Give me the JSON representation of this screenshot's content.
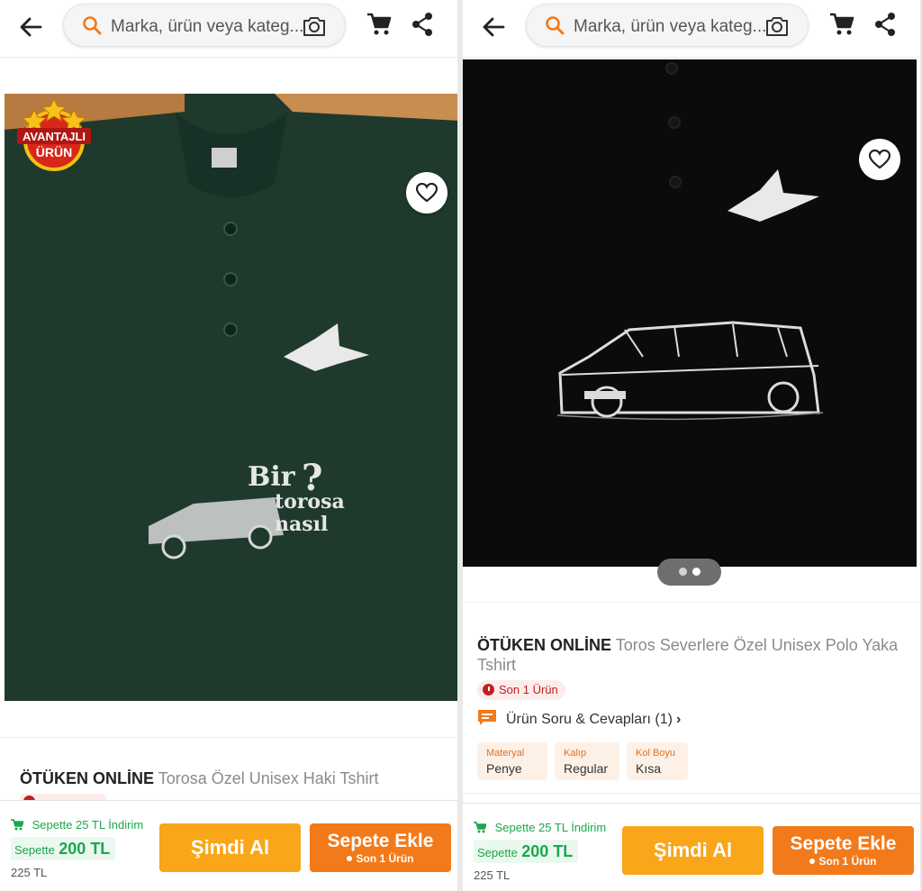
{
  "colors": {
    "accent_orange": "#f27a1a",
    "buy_yellow": "#f9a61a",
    "discount_green": "#1aa84c",
    "stock_red": "#c21f1f"
  },
  "header": {
    "search_placeholder": "Marka, ürün veya kateg..."
  },
  "icons": [
    "back-arrow-icon",
    "search-icon",
    "camera-icon",
    "cart-icon",
    "share-icon",
    "heart-icon",
    "clock-icon",
    "chat-icon"
  ],
  "left_screen": {
    "badge": {
      "line1": "AVANTAJLI",
      "line2": "ÜRÜN"
    },
    "product": {
      "brand": "ÖTÜKEN ONLİNE",
      "name": "Torosa Özel Unisex Haki Tshirt"
    },
    "bottom": {
      "promo": "Sepette 25 TL İndirim",
      "price_label": "Sepette",
      "price": "200 TL",
      "old_price": "225 TL",
      "buy_now": "Şimdi Al",
      "add_to_cart": "Sepete Ekle",
      "add_to_cart_sub": "Son 1 Ürün"
    }
  },
  "right_screen": {
    "gallery": {
      "total": 2,
      "active": 2
    },
    "product": {
      "brand": "ÖTÜKEN ONLİNE",
      "name": "Toros Severlere Özel Unisex Polo Yaka Tshirt"
    },
    "stock": "Son 1 Ürün",
    "qa_link": "Ürün Soru & Cevapları (1)",
    "attributes": [
      {
        "key": "Materyal",
        "value": "Penye"
      },
      {
        "key": "Kalıp",
        "value": "Regular"
      },
      {
        "key": "Kol Boyu",
        "value": "Kısa"
      }
    ],
    "bottom": {
      "promo": "Sepette 25 TL İndirim",
      "price_label": "Sepette",
      "price": "200 TL",
      "old_price": "225 TL",
      "buy_now": "Şimdi Al",
      "add_to_cart": "Sepete Ekle",
      "add_to_cart_sub": "Son 1 Ürün"
    }
  }
}
